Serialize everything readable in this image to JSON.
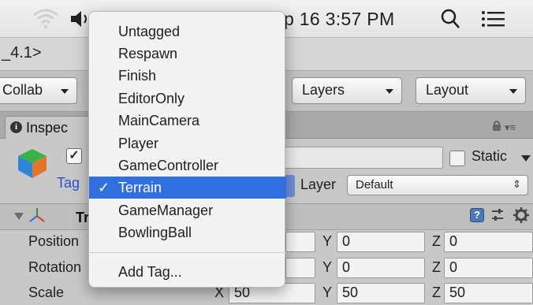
{
  "menubar": {
    "clock_text": "p 16  3:57 PM",
    "icons": [
      "wifi-icon",
      "speaker-icon",
      "search-icon",
      "list-icon"
    ]
  },
  "window": {
    "title": "_4.1>"
  },
  "toolbar": {
    "collab_label": "Collab",
    "layers_label": "Layers",
    "layout_label": "Layout"
  },
  "inspector": {
    "tab_label": "Inspec",
    "static_label": "Static",
    "tag_label": "Tag",
    "layer_label": "Layer",
    "layer_value": "Default",
    "active_check": "✓",
    "component": {
      "title": "Tr",
      "rows": [
        {
          "label": "Position",
          "y": "0",
          "z": "0"
        },
        {
          "label": "Rotation",
          "y": "0",
          "z": "0"
        },
        {
          "label": "Scale",
          "x": "50",
          "y": "50",
          "z": "50"
        }
      ]
    }
  },
  "tag_menu": {
    "items": [
      "Untagged",
      "Respawn",
      "Finish",
      "EditorOnly",
      "MainCamera",
      "Player",
      "GameController",
      "Terrain",
      "GameManager",
      "BowlingBall"
    ],
    "selected": "Terrain",
    "checkmark": "✓",
    "add_tag_label": "Add Tag..."
  },
  "colors": {
    "selection_blue": "#2f6fdf",
    "tag_label_blue": "#2b50c8"
  }
}
